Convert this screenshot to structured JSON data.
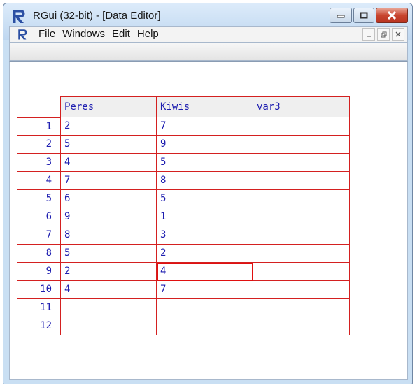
{
  "window": {
    "title": "RGui (32-bit) - [Data Editor]"
  },
  "menu": {
    "items": [
      "File",
      "Windows",
      "Edit",
      "Help"
    ]
  },
  "icons": {
    "app": "r-logo-icon",
    "minimize": "minimize-icon",
    "maximize": "maximize-icon",
    "close": "close-icon",
    "mdi_minimize": "mdi-minimize-icon",
    "mdi_restore": "mdi-restore-icon",
    "mdi_close": "mdi-close-icon"
  },
  "colors": {
    "grid_line": "#d42020",
    "cell_text": "#1d1db0",
    "header_bg": "#efefef",
    "close_button": "#c8452f"
  },
  "editor": {
    "columns": [
      "Peres",
      "Kiwis",
      "var3"
    ],
    "row_numbers": [
      "1",
      "2",
      "3",
      "4",
      "5",
      "6",
      "7",
      "8",
      "9",
      "10",
      "11",
      "12"
    ],
    "rows": [
      [
        "2",
        "7",
        ""
      ],
      [
        "5",
        "9",
        ""
      ],
      [
        "4",
        "5",
        ""
      ],
      [
        "7",
        "8",
        ""
      ],
      [
        "6",
        "5",
        ""
      ],
      [
        "9",
        "1",
        ""
      ],
      [
        "8",
        "3",
        ""
      ],
      [
        "5",
        "2",
        ""
      ],
      [
        "2",
        "4",
        ""
      ],
      [
        "4",
        "7",
        ""
      ],
      [
        "",
        "",
        ""
      ],
      [
        "",
        "",
        ""
      ]
    ],
    "selected_cell": {
      "row": 9,
      "column": "Kiwis"
    }
  }
}
